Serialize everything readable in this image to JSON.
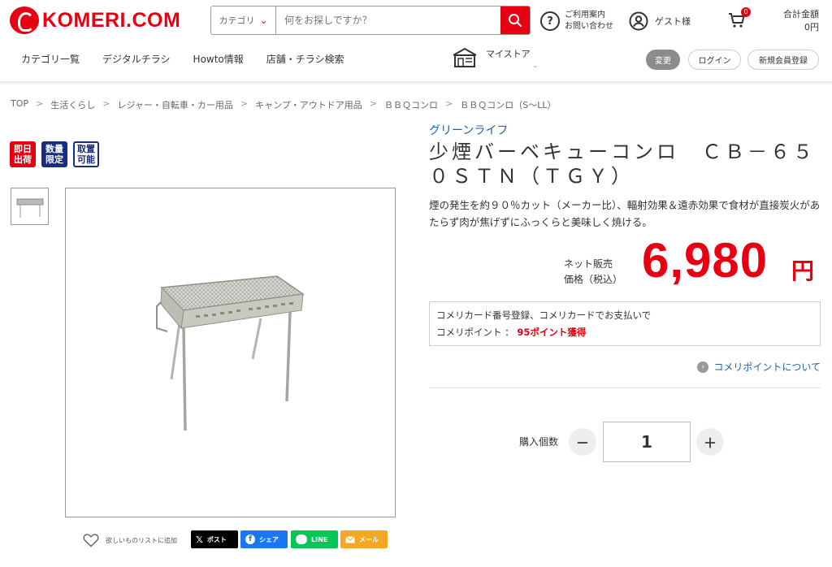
{
  "header": {
    "logo_text": "KOMERI.COM",
    "search": {
      "category_label": "カテゴリ",
      "placeholder": "何をお探しですか？"
    },
    "help_line1": "ご利用案内",
    "help_line2": "お問い合わせ",
    "guest_label": "ゲスト様",
    "cart_count": "0",
    "total_label": "合計金額",
    "total_value": "0円"
  },
  "nav": {
    "items": [
      "カテゴリ一覧",
      "デジタルチラシ",
      "Howto情報",
      "店舗・チラシ検索"
    ],
    "mystore": "マイストア",
    "change": "変更",
    "login": "ログイン",
    "register": "新規会員登録"
  },
  "breadcrumb": [
    "TOP",
    "生活くらし",
    "レジャー・自転車・カー用品",
    "キャンプ・アウトドア用品",
    "ＢＢＱコンロ",
    "ＢＢＱコンロ（S～LL）"
  ],
  "badges": [
    {
      "line1": "即日",
      "line2": "出荷"
    },
    {
      "line1": "数量",
      "line2": "限定"
    },
    {
      "line1": "取置",
      "line2": "可能"
    }
  ],
  "product": {
    "brand": "グリーンライフ",
    "title": "少煙バーベキューコンロ　ＣＢ－６５０ＳＴＮ（ＴＧＹ）",
    "description": "煙の発生を約９０％カット（メーカー比）、輻射効果＆遠赤効果で食材が直接炭火があたらず肉が焦げずにふっくらと美味しく焼ける。",
    "price_label_1": "ネット販売",
    "price_label_2": "価格（税込）",
    "price": "6,980",
    "price_unit": "円",
    "point_line1": "コメリカード番号登録、コメリカードでお支払いで",
    "point_label": "コメリポイント ： ",
    "point_value": "95ポイント獲得",
    "about_points": "コメリポイントについて",
    "qty_label": "購入個数",
    "qty_value": "1",
    "minus": "－",
    "plus": "＋"
  },
  "share": {
    "wishlist": "欲しいものリストに追加",
    "post": "ポスト",
    "facebook": "シェア",
    "line": "LINE",
    "mail": "メール"
  },
  "colors": {
    "brand_red": "#e60012",
    "link_blue": "#1e63a6",
    "navy": "#1a2d7c"
  }
}
